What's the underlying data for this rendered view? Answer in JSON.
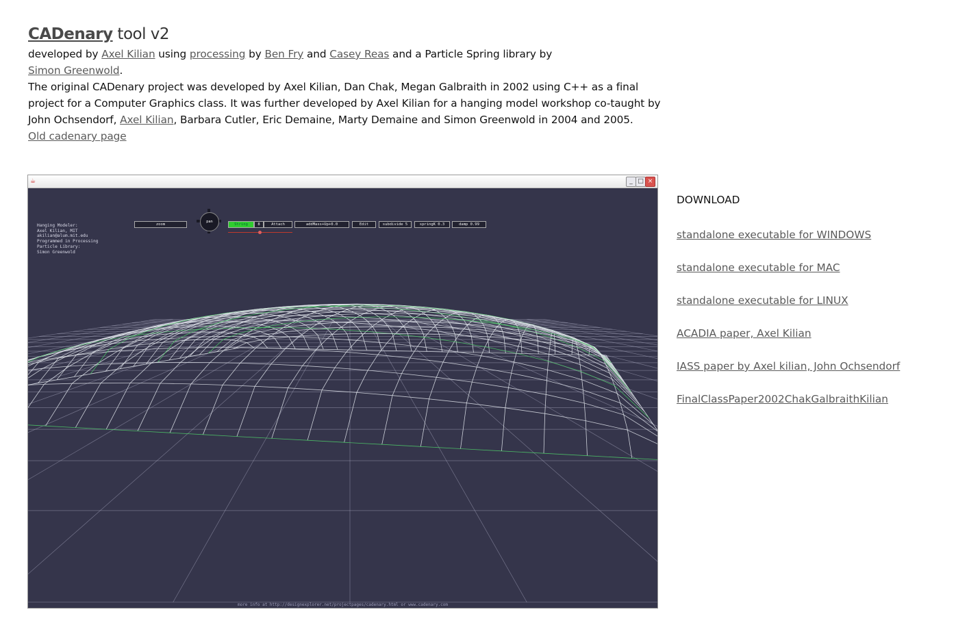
{
  "header": {
    "title_link": "CADenary",
    "title_rest": " tool v2"
  },
  "intro": {
    "p1": {
      "t1": "developed by ",
      "l1": "Axel Kilian",
      "t2": " using ",
      "l2": "processing",
      "t3": " by ",
      "l3": "Ben Fry",
      "t4": " and ",
      "l4": "Casey Reas",
      "t5": " and a Particle Spring library by ",
      "l5": "Simon Greenwold",
      "t6": "."
    },
    "p2": {
      "t1": "The original CADenary project was developed by Axel Kilian, Dan Chak, Megan Galbraith in 2002 using C++ as a final project for a Computer Graphics class. It was further developed by Axel Kilian for a hanging model workshop co-taught by John Ochsendorf, ",
      "l1": "Axel Kilian",
      "t2": ", Barbara Cutler, Eric Demaine, Marty Demaine and Simon Greenwold in 2004 and 2005."
    },
    "old_page_link": "Old cadenary page"
  },
  "app_window": {
    "icon": "java-icon",
    "buttons": {
      "minimize": "_",
      "maximize": "□",
      "close": "×"
    },
    "credits": [
      "Hanging Modeler:",
      "Axel Kilian, MIT",
      "akilian@alum.mit.edu",
      "Programmed in Processing",
      "Particle Library:",
      "Simon Greenwold"
    ],
    "controls": {
      "zoom": "zoom",
      "pad": "pan",
      "string": "String",
      "string_val": "8",
      "attach": "Attach",
      "mass": "addMass+Up+0.0",
      "edit": "Edit",
      "subdiv": "subdivide 5",
      "ss": "springK 0.3",
      "tlbss": "damp 0.99"
    },
    "footer_note": "more info at http://designexplorer.net/projectpages/cadenary.html or www.cadenary.com"
  },
  "sidebar": {
    "heading": "DOWNLOAD",
    "links": [
      "standalone executable for WINDOWS",
      "standalone executable for MAC",
      "standalone executable for LINUX",
      "ACADIA paper, Axel Kilian ",
      "IASS paper by Axel kilian, John Ochsendorf",
      "FinalClassPaper2002ChakGalbraithKilian"
    ]
  },
  "colors": {
    "link": "#5a5a5a",
    "viewport_bg": "#35354b",
    "grid": "#a8a8c0",
    "mesh": "#dfe3ea",
    "mesh_accent": "#4fcf6a"
  }
}
